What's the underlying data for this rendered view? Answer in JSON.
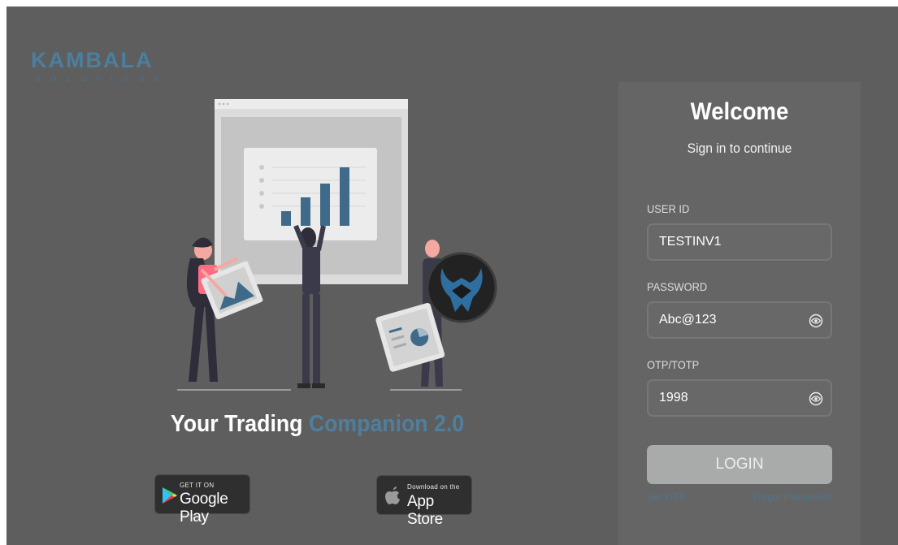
{
  "brand": {
    "logo_text": "KAMBALA",
    "logo_subtext": "SOLUTIONS"
  },
  "tagline": {
    "main": "Your Trading ",
    "accent": "Companion 2.0"
  },
  "store_badges": {
    "google": {
      "small": "GET IT ON",
      "big": "Google Play"
    },
    "apple": {
      "small": "Download on the",
      "big": "App Store"
    }
  },
  "login": {
    "title": "Welcome",
    "subtitle": "Sign in to continue",
    "user_id_label": "USER ID",
    "user_id_value": "TESTINV1",
    "password_label": "PASSWORD",
    "password_value": "Abc@123",
    "otp_label": "OTP/TOTP",
    "otp_value": "1998",
    "login_button": "LOGIN",
    "get_otp_link": "Get OTP",
    "forgot_password_link": "Forgot Password?"
  },
  "colors": {
    "background": "#5e5e5e",
    "panel": "#656565",
    "accent": "#4f7f9e",
    "button": "#a9abab"
  },
  "chart_data": {
    "type": "bar",
    "values": [
      18,
      35,
      52,
      72
    ]
  }
}
